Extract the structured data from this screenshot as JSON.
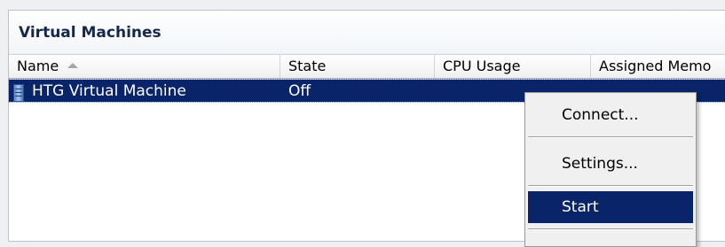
{
  "panel": {
    "title": "Virtual Machines"
  },
  "columns": [
    {
      "label": "Name"
    },
    {
      "label": "State"
    },
    {
      "label": "CPU Usage"
    },
    {
      "label": "Assigned Memo"
    }
  ],
  "rows": [
    {
      "name": "HTG Virtual Machine",
      "state": "Off",
      "icon": "vm-server-icon"
    }
  ],
  "context_menu": {
    "items": [
      {
        "label": "Connect..."
      },
      {
        "label": "Settings..."
      },
      {
        "label": "Start"
      }
    ],
    "selected": "Start"
  },
  "colors": {
    "selection": "#0a246a",
    "title_text": "#15284b"
  }
}
